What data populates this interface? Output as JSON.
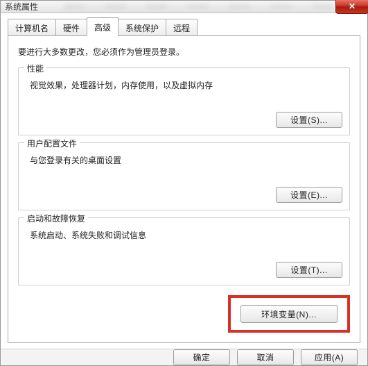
{
  "title": "系统属性",
  "tabs": {
    "computer_name": "计算机名",
    "hardware": "硬件",
    "advanced": "高级",
    "system_protection": "系统保护",
    "remote": "远程"
  },
  "admin_note": "要进行大多数更改，您必须作为管理员登录。",
  "performance": {
    "legend": "性能",
    "desc": "视觉效果，处理器计划，内存使用，以及虚拟内存",
    "button": "设置(S)..."
  },
  "user_profiles": {
    "legend": "用户配置文件",
    "desc": "与您登录有关的桌面设置",
    "button": "设置(E)..."
  },
  "startup_recovery": {
    "legend": "启动和故障恢复",
    "desc": "系统启动、系统失败和调试信息",
    "button": "设置(T)..."
  },
  "env_vars_button": "环境变量(N)...",
  "dialog": {
    "ok": "确定",
    "cancel": "取消",
    "apply": "应用(A)"
  }
}
